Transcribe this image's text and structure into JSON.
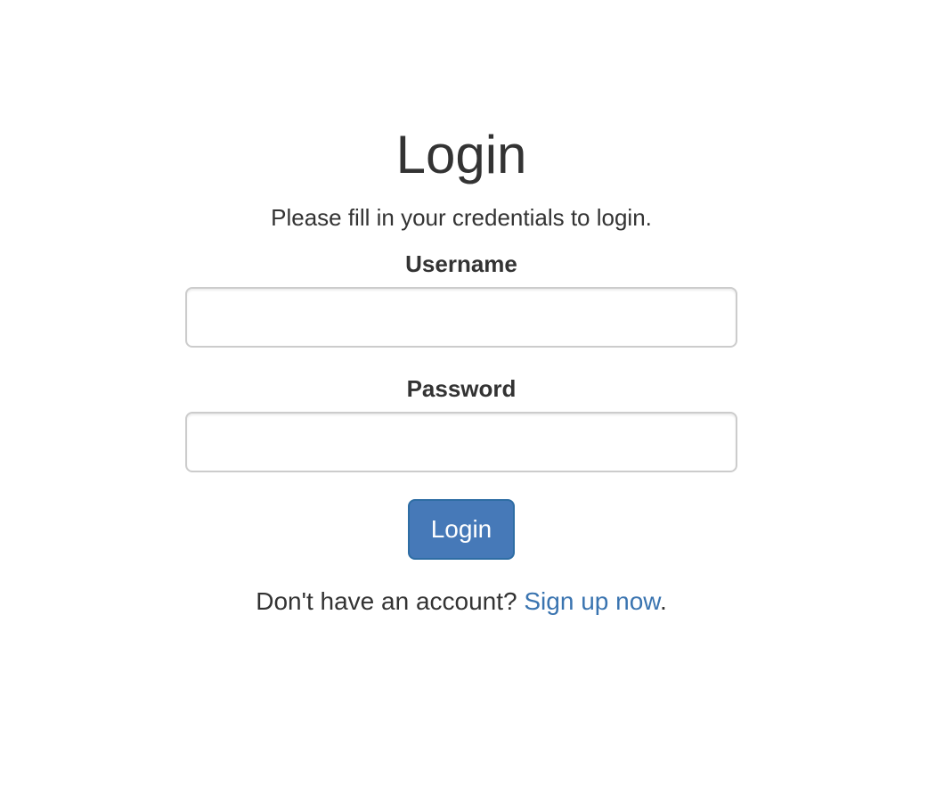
{
  "page": {
    "title": "Login",
    "subtitle": "Please fill in your credentials to login."
  },
  "form": {
    "username": {
      "label": "Username",
      "value": "",
      "placeholder": ""
    },
    "password": {
      "label": "Password",
      "value": "",
      "placeholder": ""
    },
    "submit_label": "Login"
  },
  "signup": {
    "prompt": "Don't have an account? ",
    "link_label": "Sign up now",
    "suffix": "."
  },
  "colors": {
    "button_background": "#4679b8",
    "button_border": "#2e6da4",
    "link": "#3a74b0",
    "text": "#333333",
    "input_border": "#cccccc"
  }
}
